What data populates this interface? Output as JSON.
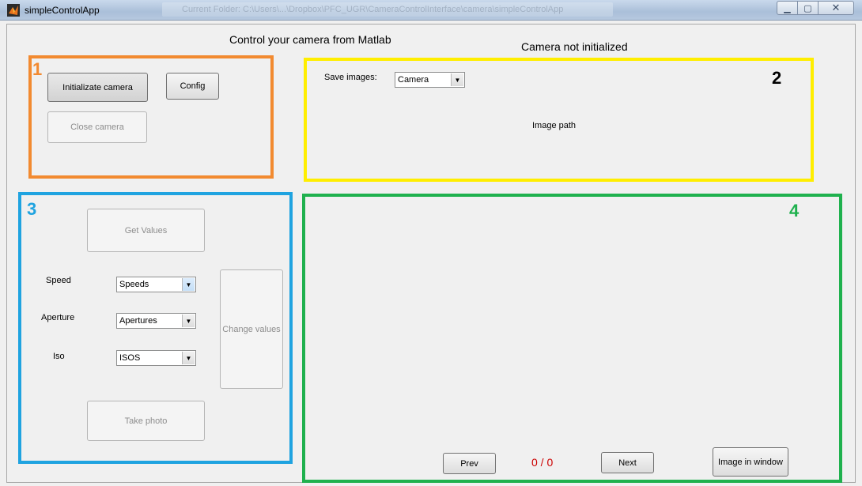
{
  "window": {
    "title": "simpleControlApp",
    "title_path": "Current Folder: C:\\Users\\...\\Dropbox\\PFC_UGR\\CameraControlInterface\\camera\\simpleControlApp"
  },
  "header": {
    "title": "Control your camera from Matlab",
    "status": "Camera not initialized"
  },
  "regions": {
    "r1": {
      "number": "1",
      "color": "#f28a30"
    },
    "r2": {
      "number": "2",
      "color": "#ffee00"
    },
    "r3": {
      "number": "3",
      "color": "#1fa3e0"
    },
    "r4": {
      "number": "4",
      "color": "#1fb14e"
    }
  },
  "camera_panel": {
    "init_label": "Initializate camera",
    "config_label": "Config",
    "close_label": "Close camera"
  },
  "save_panel": {
    "save_label": "Save images:",
    "save_option": "Camera",
    "path_label": "Image path"
  },
  "settings_panel": {
    "get_values_label": "Get Values",
    "speed_label": "Speed",
    "speed_value": "Speeds",
    "aperture_label": "Aperture",
    "aperture_value": "Apertures",
    "iso_label": "Iso",
    "iso_value": "ISOS",
    "change_values_label": "Change values",
    "take_photo_label": "Take photo"
  },
  "viewer": {
    "prev_label": "Prev",
    "counter": "0 / 0",
    "counter_color": "#cc0000",
    "next_label": "Next",
    "window_label": "Image in window"
  },
  "icons": {
    "app": "matlab-icon",
    "minimize": "minimize-icon",
    "maximize": "maximize-icon",
    "close": "close-icon",
    "dropdown": "chevron-down-icon"
  }
}
